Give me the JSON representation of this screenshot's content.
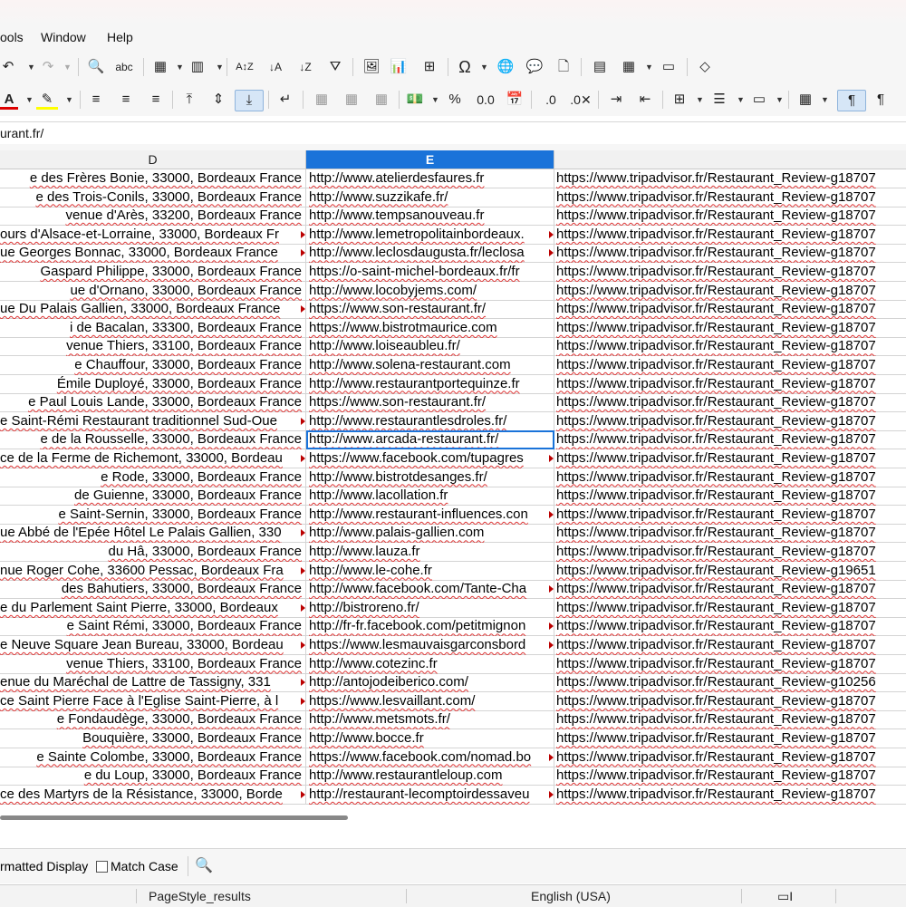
{
  "menu": {
    "tools": "ools",
    "window": "Window",
    "help": "Help"
  },
  "formula_bar": {
    "text": "urant.fr/"
  },
  "columns": {
    "d": "D",
    "e": "E"
  },
  "rows": [
    {
      "d": "e des Frères Bonie, 33000, Bordeaux France",
      "e": "http://www.atelierdesfaures.fr",
      "f": "https://www.tripadvisor.fr/Restaurant_Review-g18707"
    },
    {
      "d": "e des Trois-Conils, 33000, Bordeaux France",
      "e": "http://www.suzzikafe.fr/",
      "f": "https://www.tripadvisor.fr/Restaurant_Review-g18707"
    },
    {
      "d": "venue d'Arès, 33200, Bordeaux France",
      "e": "http://www.tempsanouveau.fr",
      "f": "https://www.tripadvisor.fr/Restaurant_Review-g18707"
    },
    {
      "d": "ours d'Alsace-et-Lorraine, 33000, Bordeaux Fr",
      "e": "http://www.lemetropolitainbordeaux.",
      "f": "https://www.tripadvisor.fr/Restaurant_Review-g18707"
    },
    {
      "d": "ue Georges Bonnac, 33000, Bordeaux France",
      "e": "http://www.leclosdaugusta.fr/leclosa",
      "f": "https://www.tripadvisor.fr/Restaurant_Review-g18707"
    },
    {
      "d": "Gaspard Philippe, 33000, Bordeaux France",
      "e": "https://o-saint-michel-bordeaux.fr/fr",
      "f": "https://www.tripadvisor.fr/Restaurant_Review-g18707"
    },
    {
      "d": "ue d'Ornano, 33000, Bordeaux France",
      "e": "http://www.locobyjems.com/",
      "f": "https://www.tripadvisor.fr/Restaurant_Review-g18707"
    },
    {
      "d": "ue Du Palais Gallien, 33000, Bordeaux France",
      "e": "https://www.son-restaurant.fr/",
      "f": "https://www.tripadvisor.fr/Restaurant_Review-g18707"
    },
    {
      "d": "i de Bacalan, 33300, Bordeaux France",
      "e": "https://www.bistrotmaurice.com",
      "f": "https://www.tripadvisor.fr/Restaurant_Review-g18707"
    },
    {
      "d": "venue Thiers, 33100, Bordeaux France",
      "e": "http://www.loiseaubleu.fr/",
      "f": "https://www.tripadvisor.fr/Restaurant_Review-g18707"
    },
    {
      "d": "e Chauffour, 33000, Bordeaux France",
      "e": "http://www.solena-restaurant.com",
      "f": "https://www.tripadvisor.fr/Restaurant_Review-g18707"
    },
    {
      "d": "Émile Duployé, 33000, Bordeaux France",
      "e": "http://www.restaurantportequinze.fr",
      "f": "https://www.tripadvisor.fr/Restaurant_Review-g18707"
    },
    {
      "d": "e Paul Louis Lande, 33000, Bordeaux France",
      "e": "https://www.son-restaurant.fr/",
      "f": "https://www.tripadvisor.fr/Restaurant_Review-g18707"
    },
    {
      "d": "e Saint-Rémi Restaurant traditionnel Sud-Oue",
      "e": "http://www.restaurantlesdroles.fr/",
      "f": "https://www.tripadvisor.fr/Restaurant_Review-g18707"
    },
    {
      "d": "e de la Rousselle, 33000, Bordeaux France",
      "e": "http://www.arcada-restaurant.fr/",
      "f": "https://www.tripadvisor.fr/Restaurant_Review-g18707"
    },
    {
      "d": "ce de la Ferme de Richemont, 33000, Bordeau",
      "e": "https://www.facebook.com/tupagres",
      "f": "https://www.tripadvisor.fr/Restaurant_Review-g18707"
    },
    {
      "d": "e Rode, 33000, Bordeaux France",
      "e": "http://www.bistrotdesanges.fr/",
      "f": "https://www.tripadvisor.fr/Restaurant_Review-g18707"
    },
    {
      "d": "de Guienne, 33000, Bordeaux France",
      "e": "http://www.lacollation.fr",
      "f": "https://www.tripadvisor.fr/Restaurant_Review-g18707"
    },
    {
      "d": "e Saint-Sernin, 33000, Bordeaux France",
      "e": "http://www.restaurant-influences.con",
      "f": "https://www.tripadvisor.fr/Restaurant_Review-g18707"
    },
    {
      "d": "ue Abbé de l'Epée Hôtel Le Palais Gallien, 330",
      "e": "http://www.palais-gallien.com",
      "f": "https://www.tripadvisor.fr/Restaurant_Review-g18707"
    },
    {
      "d": "du Hâ, 33000, Bordeaux France",
      "e": "http://www.lauza.fr",
      "f": "https://www.tripadvisor.fr/Restaurant_Review-g18707"
    },
    {
      "d": "nue Roger Cohe, 33600 Pessac, Bordeaux Fra",
      "e": "http://www.le-cohe.fr",
      "f": "https://www.tripadvisor.fr/Restaurant_Review-g19651"
    },
    {
      "d": "des Bahutiers, 33000, Bordeaux France",
      "e": "http://www.facebook.com/Tante-Cha",
      "f": "https://www.tripadvisor.fr/Restaurant_Review-g18707"
    },
    {
      "d": "e du Parlement Saint Pierre, 33000, Bordeaux",
      "e": "http://bistroreno.fr/",
      "f": "https://www.tripadvisor.fr/Restaurant_Review-g18707"
    },
    {
      "d": "e Saint Rémi, 33000, Bordeaux France",
      "e": "http://fr-fr.facebook.com/petitmignon",
      "f": "https://www.tripadvisor.fr/Restaurant_Review-g18707"
    },
    {
      "d": "e Neuve Square Jean Bureau, 33000, Bordeau",
      "e": "https://www.lesmauvaisgarconsbord",
      "f": "https://www.tripadvisor.fr/Restaurant_Review-g18707"
    },
    {
      "d": "venue Thiers, 33100, Bordeaux France",
      "e": "http://www.cotezinc.fr",
      "f": "https://www.tripadvisor.fr/Restaurant_Review-g18707"
    },
    {
      "d": "enue du Maréchal de Lattre de Tassigny, 331",
      "e": "http://antojodeiberico.com/",
      "f": "https://www.tripadvisor.fr/Restaurant_Review-g10256"
    },
    {
      "d": "ce Saint Pierre Face à l'Eglise Saint-Pierre, à l",
      "e": "https://www.lesvaillant.com/",
      "f": "https://www.tripadvisor.fr/Restaurant_Review-g18707"
    },
    {
      "d": "e Fondaudège, 33000, Bordeaux France",
      "e": "http://www.metsmots.fr/",
      "f": "https://www.tripadvisor.fr/Restaurant_Review-g18707"
    },
    {
      "d": "Bouquière, 33000, Bordeaux France",
      "e": "http://www.bocce.fr",
      "f": "https://www.tripadvisor.fr/Restaurant_Review-g18707"
    },
    {
      "d": "e Sainte Colombe, 33000, Bordeaux France",
      "e": "https://www.facebook.com/nomad.bo",
      "f": "https://www.tripadvisor.fr/Restaurant_Review-g18707"
    },
    {
      "d": "e du Loup, 33000, Bordeaux France",
      "e": "http://www.restaurantleloup.com",
      "f": "https://www.tripadvisor.fr/Restaurant_Review-g18707"
    },
    {
      "d": "ce des Martyrs de la Résistance, 33000, Borde",
      "e": "http://restaurant-lecomptoirdessaveu",
      "f": "https://www.tripadvisor.fr/Restaurant_Review-g18707"
    }
  ],
  "overflow_rows_d": [
    3,
    4,
    7,
    13,
    15,
    19,
    21,
    23,
    25,
    27,
    28,
    33
  ],
  "overflow_rows_e": [
    3,
    4,
    15,
    18,
    22,
    24,
    25,
    31,
    33
  ],
  "active_row": 14,
  "findbar": {
    "formatted_display": "rmatted Display",
    "match_case": "Match Case"
  },
  "status": {
    "page_style": "PageStyle_results",
    "language": "English (USA)"
  },
  "accent_color": "#1a73d9"
}
